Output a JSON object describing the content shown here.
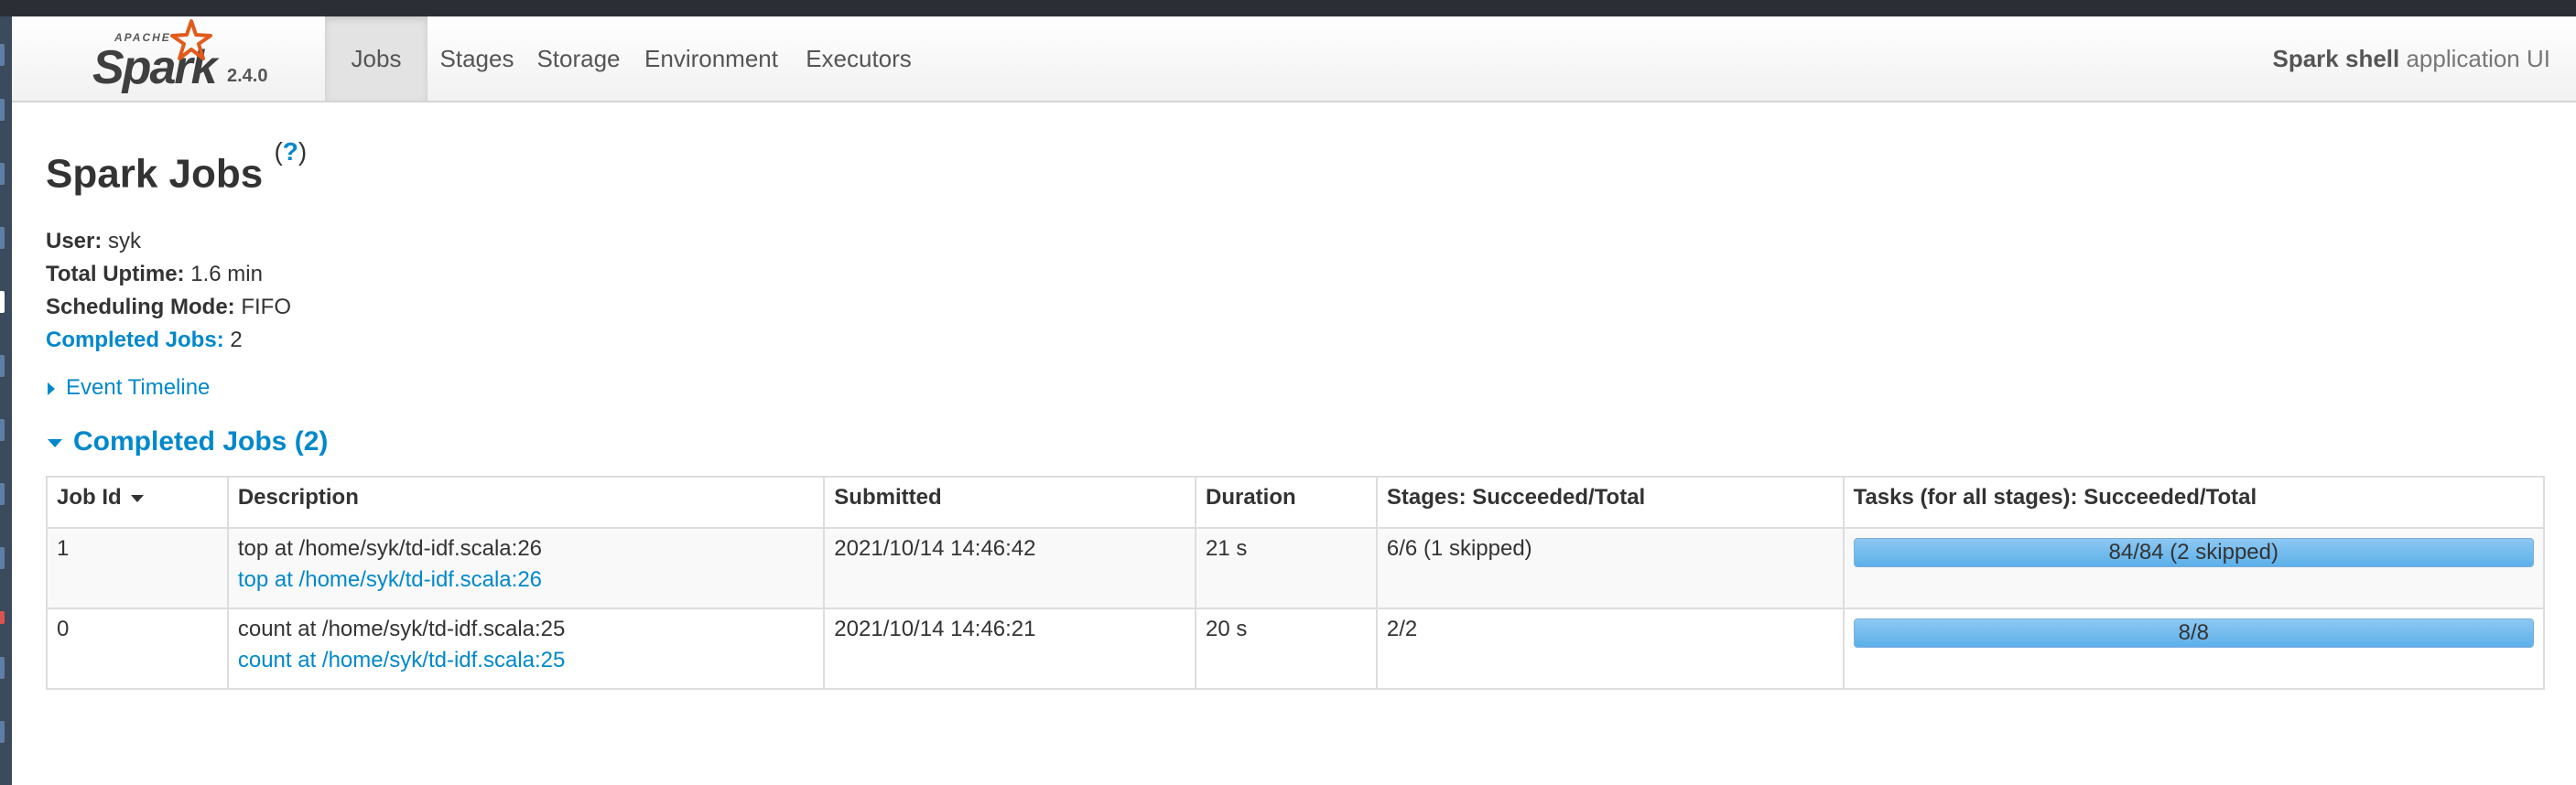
{
  "navbar": {
    "logo_small": "APACHE",
    "logo_text": "Spark",
    "version": "2.4.0",
    "tabs": [
      {
        "label": "Jobs",
        "active": true
      },
      {
        "label": "Stages",
        "active": false
      },
      {
        "label": "Storage",
        "active": false
      },
      {
        "label": "Environment",
        "active": false
      },
      {
        "label": "Executors",
        "active": false
      }
    ],
    "app_name": "Spark shell",
    "app_suffix": " application UI"
  },
  "page": {
    "title": "Spark Jobs",
    "help": "?"
  },
  "summary": {
    "user_label": "User:",
    "user": "syk",
    "uptime_label": "Total Uptime:",
    "uptime": "1.6 min",
    "mode_label": "Scheduling Mode:",
    "mode": "FIFO",
    "completed_label": "Completed Jobs:",
    "completed": "2"
  },
  "event_timeline": "Event Timeline",
  "completed_section": "Completed Jobs (2)",
  "table": {
    "headers": {
      "job_id": "Job Id",
      "description": "Description",
      "submitted": "Submitted",
      "duration": "Duration",
      "stages": "Stages: Succeeded/Total",
      "tasks": "Tasks (for all stages): Succeeded/Total"
    },
    "rows": [
      {
        "job_id": "1",
        "description": "top at /home/syk/td-idf.scala:26",
        "description_link": "top at /home/syk/td-idf.scala:26",
        "submitted": "2021/10/14 14:46:42",
        "duration": "21 s",
        "stages": "6/6 (1 skipped)",
        "tasks": "84/84 (2 skipped)",
        "tasks_fraction": 1.0
      },
      {
        "job_id": "0",
        "description": "count at /home/syk/td-idf.scala:25",
        "description_link": "count at /home/syk/td-idf.scala:25",
        "submitted": "2021/10/14 14:46:21",
        "duration": "20 s",
        "stages": "2/2",
        "tasks": "8/8",
        "tasks_fraction": 1.0
      }
    ]
  }
}
